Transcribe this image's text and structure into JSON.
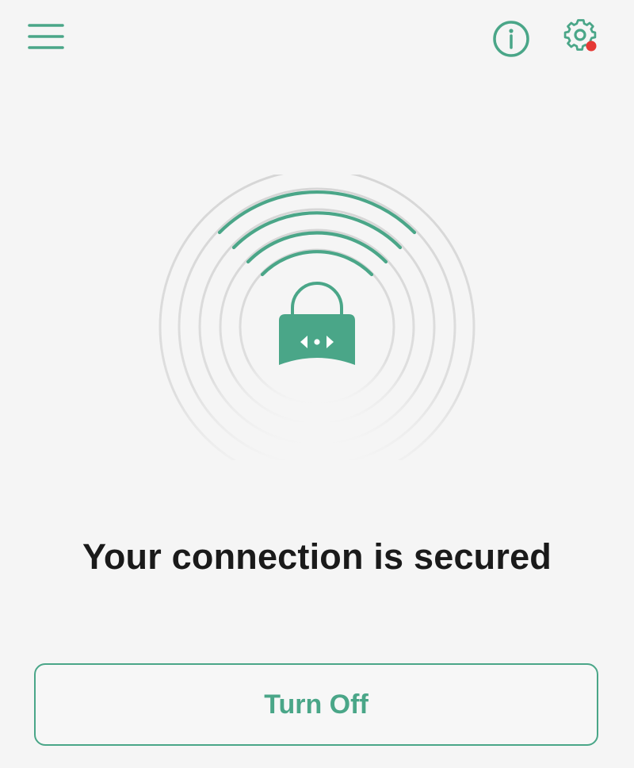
{
  "status": {
    "title": "Your connection is secured"
  },
  "actions": {
    "turn_off_label": "Turn Off"
  },
  "icons": {
    "menu": "menu-icon",
    "info": "info-icon",
    "settings": "gear-icon",
    "lock": "lock-icon"
  },
  "colors": {
    "accent": "#4aa688",
    "badge": "#e53935",
    "background": "#f5f5f5",
    "text": "#1a1a1a"
  },
  "settings_badge": true
}
